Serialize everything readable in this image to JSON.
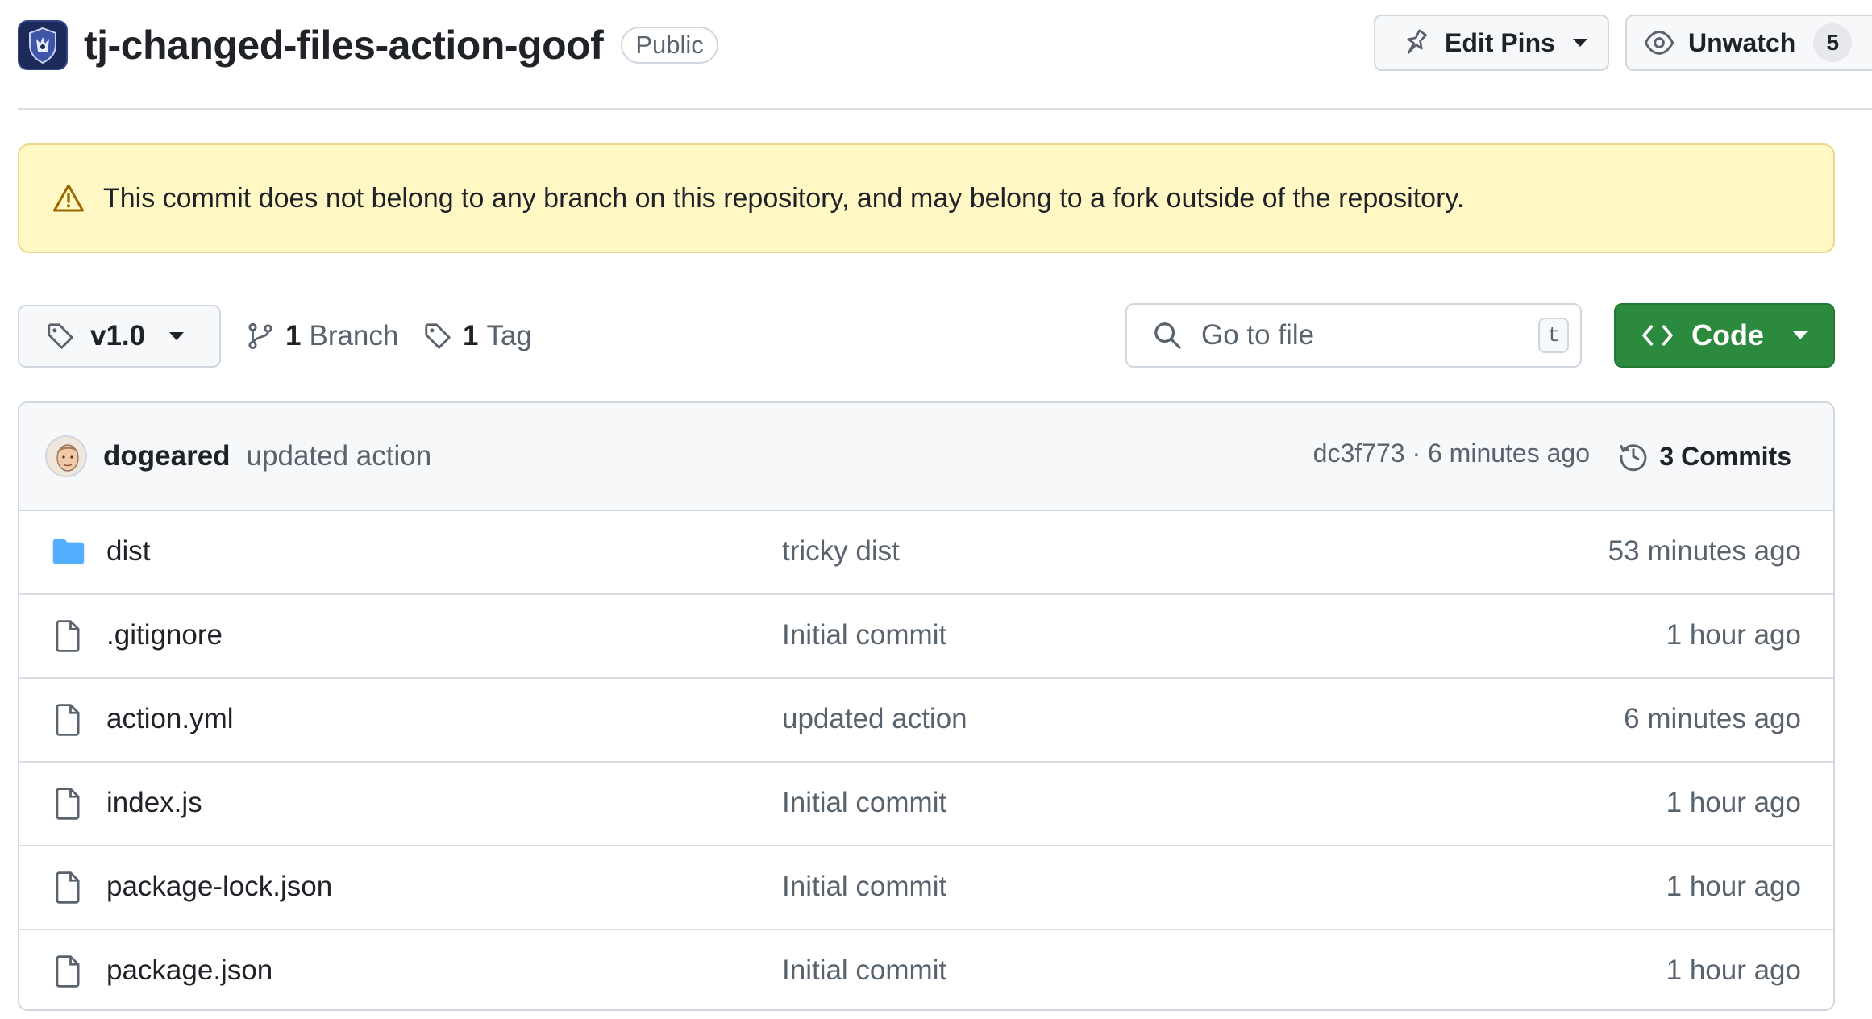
{
  "repo": {
    "name": "tj-changed-files-action-goof",
    "visibility": "Public"
  },
  "header_actions": {
    "edit_pins_label": "Edit Pins",
    "watch_label": "Unwatch",
    "watch_count": "5"
  },
  "banner": {
    "message": "This commit does not belong to any branch on this repository, and may belong to a fork outside of the repository."
  },
  "toolbar": {
    "ref": "v1.0",
    "branch_count": "1",
    "branch_label": "Branch",
    "tag_count": "1",
    "tag_label": "Tag",
    "search_placeholder": "Go to file",
    "search_shortcut": "t",
    "code_label": "Code"
  },
  "latest_commit": {
    "author": "dogeared",
    "message": "updated action",
    "meta": "dc3f773 · 6 minutes ago",
    "commits_label": "3 Commits"
  },
  "files": [
    {
      "name": "dist",
      "type": "folder",
      "commit": "tricky dist",
      "age": "53 minutes ago"
    },
    {
      "name": ".gitignore",
      "type": "file",
      "commit": "Initial commit",
      "age": "1 hour ago"
    },
    {
      "name": "action.yml",
      "type": "file",
      "commit": "updated action",
      "age": "6 minutes ago"
    },
    {
      "name": "index.js",
      "type": "file",
      "commit": "Initial commit",
      "age": "1 hour ago"
    },
    {
      "name": "package-lock.json",
      "type": "file",
      "commit": "Initial commit",
      "age": "1 hour ago"
    },
    {
      "name": "package.json",
      "type": "file",
      "commit": "Initial commit",
      "age": "1 hour ago"
    }
  ],
  "colors": {
    "banner_bg": "#fff8c5",
    "code_button": "#2c8a3f",
    "folder_icon": "#54aeff"
  }
}
